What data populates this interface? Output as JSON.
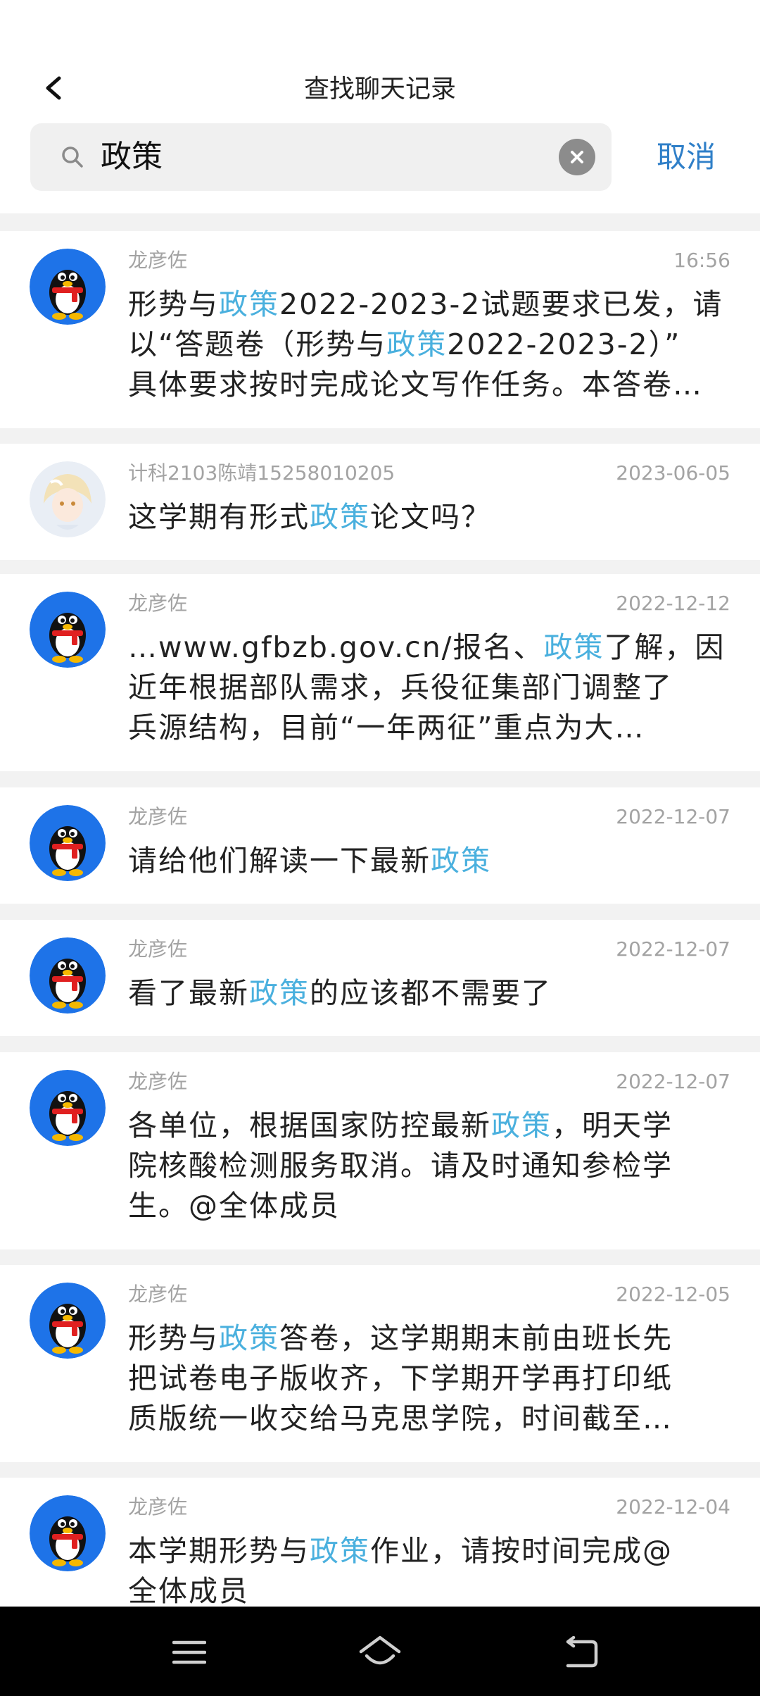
{
  "header": {
    "title": "查找聊天记录",
    "search_value": "政策",
    "cancel_label": "取消"
  },
  "colors": {
    "highlight": "#4ab0de",
    "cancel": "#2f7fc8",
    "meta_gray": "#a3a3a3",
    "avatar_blue": "#1e73e8"
  },
  "results": [
    {
      "sender": "龙彦佐",
      "time": "16:56",
      "avatar": "qq-penguin-avatar",
      "lines": [
        [
          "形势与",
          "政策",
          "2022-2023-2试题要求已发，请"
        ],
        [
          "以“答题卷（形势与",
          "政策",
          "2022-2023-2）”"
        ],
        [
          "具体要求按时完成论文写作任务。本答卷…",
          "",
          ""
        ]
      ]
    },
    {
      "sender": "计科2103陈靖15258010205",
      "time": "2023-06-05",
      "avatar": "anime-girl-avatar",
      "lines": [
        [
          "这学期有形式",
          "政策",
          "论文吗？"
        ]
      ]
    },
    {
      "sender": "龙彦佐",
      "time": "2022-12-12",
      "avatar": "qq-penguin-avatar",
      "lines": [
        [
          "…www.gfbzb.gov.cn/报名、",
          "政策",
          "了解，因"
        ],
        [
          "近年根据部队需求，兵役征集部门调整了",
          "",
          ""
        ],
        [
          "兵源结构，目前“一年两征”重点为大…",
          "",
          ""
        ]
      ]
    },
    {
      "sender": "龙彦佐",
      "time": "2022-12-07",
      "avatar": "qq-penguin-avatar",
      "lines": [
        [
          "请给他们解读一下最新",
          "政策",
          ""
        ]
      ]
    },
    {
      "sender": "龙彦佐",
      "time": "2022-12-07",
      "avatar": "qq-penguin-avatar",
      "lines": [
        [
          "看了最新",
          "政策",
          "的应该都不需要了"
        ]
      ]
    },
    {
      "sender": "龙彦佐",
      "time": "2022-12-07",
      "avatar": "qq-penguin-avatar",
      "lines": [
        [
          "各单位，根据国家防控最新",
          "政策",
          "，明天学"
        ],
        [
          "院核酸检测服务取消。请及时通知参检学",
          "",
          ""
        ],
        [
          "生。@全体成员",
          "",
          ""
        ]
      ]
    },
    {
      "sender": "龙彦佐",
      "time": "2022-12-05",
      "avatar": "qq-penguin-avatar",
      "lines": [
        [
          "形势与",
          "政策",
          "答卷，这学期期末前由班长先"
        ],
        [
          "把试卷电子版收齐，下学期开学再打印纸",
          "",
          ""
        ],
        [
          "质版统一收交给马克思学院，时间截至…",
          "",
          ""
        ]
      ]
    },
    {
      "sender": "龙彦佐",
      "time": "2022-12-04",
      "avatar": "qq-penguin-avatar",
      "lines": [
        [
          "本学期形势与",
          "政策",
          "作业，请按时间完成@"
        ],
        [
          "全体成员",
          "",
          ""
        ]
      ]
    }
  ],
  "navbar": {
    "icons": [
      "menu-icon",
      "home-icon",
      "back-icon"
    ]
  }
}
